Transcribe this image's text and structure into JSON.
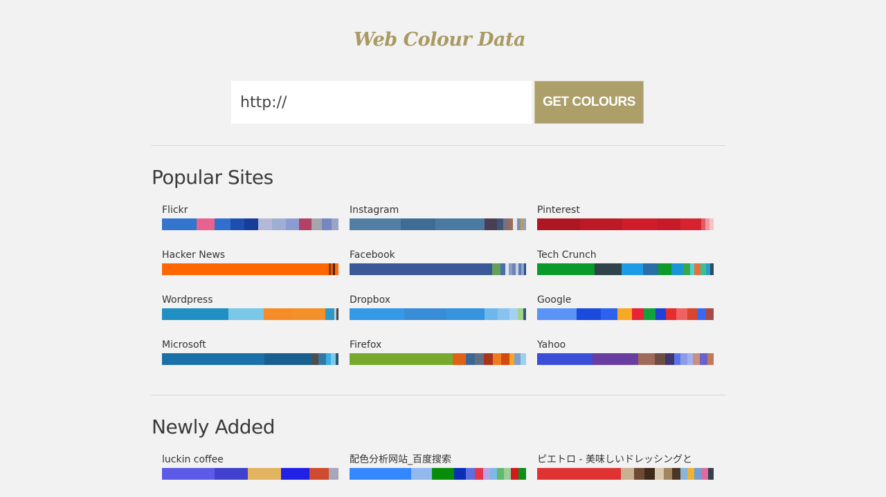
{
  "header": {
    "title": "Web Colour Data"
  },
  "search": {
    "placeholder": "http://",
    "button_label": "GET COLOURS"
  },
  "popular": {
    "title": "Popular Sites",
    "sites": [
      {
        "name": "Flickr",
        "segments": [
          {
            "color": "#3374cc",
            "weight": 50
          },
          {
            "color": "#e8628f",
            "weight": 25
          },
          {
            "color": "#2f6fcd",
            "weight": 23
          },
          {
            "color": "#1d4fae",
            "weight": 20
          },
          {
            "color": "#173d9b",
            "weight": 20
          },
          {
            "color": "#b3b8d6",
            "weight": 20
          },
          {
            "color": "#9fafd4",
            "weight": 20
          },
          {
            "color": "#8a9cd2",
            "weight": 18
          },
          {
            "color": "#b24165",
            "weight": 18
          },
          {
            "color": "#a5a5ad",
            "weight": 15
          },
          {
            "color": "#7487c0",
            "weight": 14
          },
          {
            "color": "#9aa3c8",
            "weight": 10
          }
        ]
      },
      {
        "name": "Instagram",
        "segments": [
          {
            "color": "#527ea3",
            "weight": 73
          },
          {
            "color": "#3e6c94",
            "weight": 50
          },
          {
            "color": "#4a7aa2",
            "weight": 70
          },
          {
            "color": "#4b3d53",
            "weight": 18
          },
          {
            "color": "#3e5478",
            "weight": 9
          },
          {
            "color": "#7e6e78",
            "weight": 8
          },
          {
            "color": "#a06a55",
            "weight": 6
          },
          {
            "color": "#e4e6ec",
            "weight": 6
          },
          {
            "color": "#7592b4",
            "weight": 5
          },
          {
            "color": "#c49a5a",
            "weight": 4
          },
          {
            "color": "#8ea0bb",
            "weight": 4
          }
        ]
      },
      {
        "name": "Pinterest",
        "segments": [
          {
            "color": "#ac1722",
            "weight": 62
          },
          {
            "color": "#bd1a28",
            "weight": 61
          },
          {
            "color": "#cf1d2c",
            "weight": 50
          },
          {
            "color": "#c71b2a",
            "weight": 34
          },
          {
            "color": "#d5232f",
            "weight": 30
          },
          {
            "color": "#e25a63",
            "weight": 6
          },
          {
            "color": "#ee9aa0",
            "weight": 6
          },
          {
            "color": "#f4c4c7",
            "weight": 6
          }
        ]
      },
      {
        "name": "Hacker News",
        "segments": [
          {
            "color": "#ff6600",
            "weight": 241
          },
          {
            "color": "#8a3a05",
            "weight": 3
          },
          {
            "color": "#e45d04",
            "weight": 3
          },
          {
            "color": "#4a2304",
            "weight": 3
          },
          {
            "color": "#ff6c10",
            "weight": 5
          }
        ]
      },
      {
        "name": "Facebook",
        "segments": [
          {
            "color": "#3b5998",
            "weight": 206
          },
          {
            "color": "#64a058",
            "weight": 12
          },
          {
            "color": "#4a6eb0",
            "weight": 7
          },
          {
            "color": "#dfe3ee",
            "weight": 5
          },
          {
            "color": "#8b9dc3",
            "weight": 5
          },
          {
            "color": "#6d84b4",
            "weight": 5
          },
          {
            "color": "#c8d0e2",
            "weight": 4
          },
          {
            "color": "#5d7bb4",
            "weight": 4
          },
          {
            "color": "#90a6d0",
            "weight": 4
          },
          {
            "color": "#2f4b86",
            "weight": 3
          }
        ]
      },
      {
        "name": "Tech Crunch",
        "segments": [
          {
            "color": "#0a9a2a",
            "weight": 81
          },
          {
            "color": "#2e4448",
            "weight": 39
          },
          {
            "color": "#1d9be6",
            "weight": 30
          },
          {
            "color": "#2a6ea8",
            "weight": 22
          },
          {
            "color": "#0f9a2c",
            "weight": 18
          },
          {
            "color": "#1c95d4",
            "weight": 17
          },
          {
            "color": "#3aa746",
            "weight": 10
          },
          {
            "color": "#4ad1d8",
            "weight": 6
          },
          {
            "color": "#e5703c",
            "weight": 8
          },
          {
            "color": "#3fbf8c",
            "weight": 8
          },
          {
            "color": "#2c9bd0",
            "weight": 6
          },
          {
            "color": "#2d4e5c",
            "weight": 5
          }
        ]
      },
      {
        "name": "Wordpress",
        "segments": [
          {
            "color": "#2090c3",
            "weight": 96
          },
          {
            "color": "#7ac7e8",
            "weight": 51
          },
          {
            "color": "#f58c28",
            "weight": 41
          },
          {
            "color": "#f49029",
            "weight": 48
          },
          {
            "color": "#2e98c8",
            "weight": 13
          },
          {
            "color": "#cccccc",
            "weight": 3
          },
          {
            "color": "#444444",
            "weight": 3
          }
        ]
      },
      {
        "name": "Dropbox",
        "segments": [
          {
            "color": "#3499e6",
            "weight": 79
          },
          {
            "color": "#398dd7",
            "weight": 61
          },
          {
            "color": "#3594dd",
            "weight": 55
          },
          {
            "color": "#6db7ec",
            "weight": 19
          },
          {
            "color": "#88c2ee",
            "weight": 17
          },
          {
            "color": "#a4d0f1",
            "weight": 12
          },
          {
            "color": "#9ed389",
            "weight": 8
          },
          {
            "color": "#34597a",
            "weight": 4
          }
        ]
      },
      {
        "name": "Google",
        "segments": [
          {
            "color": "#5b94f7",
            "weight": 56
          },
          {
            "color": "#1a4bdd",
            "weight": 35
          },
          {
            "color": "#2d61f0",
            "weight": 24
          },
          {
            "color": "#f9a825",
            "weight": 20
          },
          {
            "color": "#e9233a",
            "weight": 17
          },
          {
            "color": "#12a13c",
            "weight": 17
          },
          {
            "color": "#2040d8",
            "weight": 15
          },
          {
            "color": "#e52d2d",
            "weight": 15
          },
          {
            "color": "#f06161",
            "weight": 15
          },
          {
            "color": "#d9452e",
            "weight": 14
          },
          {
            "color": "#3a68f0",
            "weight": 12
          },
          {
            "color": "#a64a4a",
            "weight": 12
          }
        ]
      },
      {
        "name": "Microsoft",
        "segments": [
          {
            "color": "#1a71a8",
            "weight": 145
          },
          {
            "color": "#195f8f",
            "weight": 67
          },
          {
            "color": "#4e4e4e",
            "weight": 10
          },
          {
            "color": "#3577a2",
            "weight": 10
          },
          {
            "color": "#35b0e8",
            "weight": 7
          },
          {
            "color": "#7cc9e8",
            "weight": 7
          },
          {
            "color": "#2b5773",
            "weight": 4
          }
        ]
      },
      {
        "name": "Firefox",
        "segments": [
          {
            "color": "#77aa2c",
            "weight": 142
          },
          {
            "color": "#de6216",
            "weight": 18
          },
          {
            "color": "#3c6795",
            "weight": 12
          },
          {
            "color": "#606f83",
            "weight": 13
          },
          {
            "color": "#a8351b",
            "weight": 12
          },
          {
            "color": "#f07a1e",
            "weight": 12
          },
          {
            "color": "#d04a12",
            "weight": 11
          },
          {
            "color": "#f5a623",
            "weight": 7
          },
          {
            "color": "#7f9fcc",
            "weight": 8
          },
          {
            "color": "#9cd1ec",
            "weight": 8
          }
        ]
      },
      {
        "name": "Yahoo",
        "segments": [
          {
            "color": "#3b4ed8",
            "weight": 77
          },
          {
            "color": "#6a3ea1",
            "weight": 63
          },
          {
            "color": "#a06a58",
            "weight": 23
          },
          {
            "color": "#6e4d45",
            "weight": 15
          },
          {
            "color": "#3d3670",
            "weight": 12
          },
          {
            "color": "#5b73e8",
            "weight": 9
          },
          {
            "color": "#8a9be9",
            "weight": 9
          },
          {
            "color": "#a3b0f0",
            "weight": 8
          },
          {
            "color": "#c98f80",
            "weight": 10
          },
          {
            "color": "#6a62c8",
            "weight": 10
          },
          {
            "color": "#c07a5a",
            "weight": 9
          }
        ]
      }
    ]
  },
  "newly_added": {
    "title": "Newly Added",
    "sites": [
      {
        "name": "luckin coffee",
        "segments": [
          {
            "color": "#5b5be8",
            "weight": 76
          },
          {
            "color": "#4141cf",
            "weight": 48
          },
          {
            "color": "#e2b45f",
            "weight": 48
          },
          {
            "color": "#2121e6",
            "weight": 41
          },
          {
            "color": "#cf4a2e",
            "weight": 28
          },
          {
            "color": "#a8a7b8",
            "weight": 14
          }
        ]
      },
      {
        "name": "配色分析网站_百度搜索",
        "segments": [
          {
            "color": "#3388ff",
            "weight": 89
          },
          {
            "color": "#92b8ee",
            "weight": 30
          },
          {
            "color": "#078d0a",
            "weight": 32
          },
          {
            "color": "#0a2fb7",
            "weight": 17
          },
          {
            "color": "#5d6ee0",
            "weight": 13
          },
          {
            "color": "#e6354a",
            "weight": 12
          },
          {
            "color": "#b9a3e8",
            "weight": 10
          },
          {
            "color": "#7fb8e6",
            "weight": 10
          },
          {
            "color": "#5fb96b",
            "weight": 10
          },
          {
            "color": "#9ccc9c",
            "weight": 10
          },
          {
            "color": "#d21a1a",
            "weight": 11
          },
          {
            "color": "#0c8f1c",
            "weight": 11
          }
        ]
      },
      {
        "name": "ピエトロ - 美味しいドレッシングと",
        "segments": [
          {
            "color": "#df3333",
            "weight": 120
          },
          {
            "color": "#c8b090",
            "weight": 18
          },
          {
            "color": "#6e4a32",
            "weight": 15
          },
          {
            "color": "#3e2a1a",
            "weight": 15
          },
          {
            "color": "#d8c9b0",
            "weight": 13
          },
          {
            "color": "#a08660",
            "weight": 12
          },
          {
            "color": "#4a3622",
            "weight": 12
          },
          {
            "color": "#8ab4d8",
            "weight": 9
          },
          {
            "color": "#f0b030",
            "weight": 10
          },
          {
            "color": "#6f9ed2",
            "weight": 10
          },
          {
            "color": "#e06aa0",
            "weight": 10
          },
          {
            "color": "#354050",
            "weight": 8
          }
        ]
      }
    ]
  }
}
